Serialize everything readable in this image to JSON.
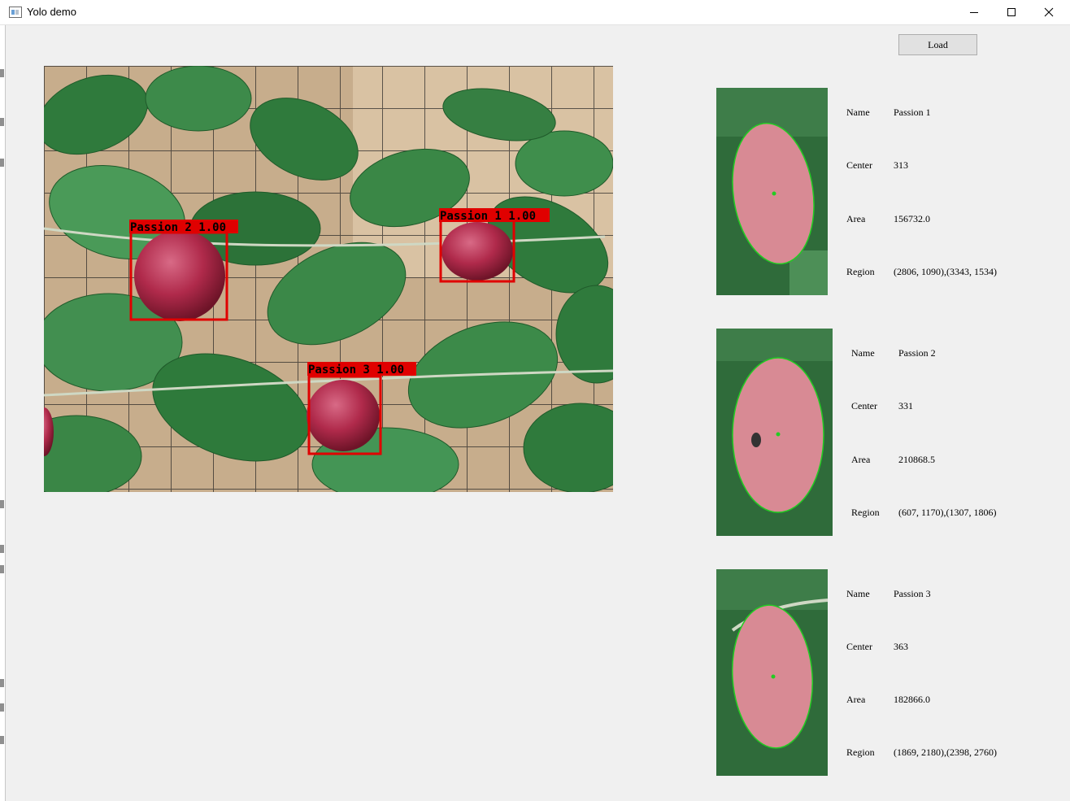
{
  "window": {
    "title": "Yolo demo",
    "icons": {
      "app": "app-window-icon",
      "minimize": "minimize-icon",
      "maximize": "maximize-icon",
      "close": "close-icon"
    }
  },
  "toolbar": {
    "load_label": "Load"
  },
  "detections": [
    {
      "label": "Passion 2 1.00"
    },
    {
      "label": "Passion 1 1.00"
    },
    {
      "label": "Passion 3 1.00"
    }
  ],
  "colors": {
    "box": "#e00000",
    "leaf": "#2f7a3c",
    "fruit": "#b8324f",
    "ellipse": "#22cc22",
    "background": "#f0f0f0"
  },
  "results": [
    {
      "name_label": "Name",
      "name": "Passion 1",
      "center_label": "Center",
      "center": "313",
      "area_label": "Area",
      "area": "156732.0",
      "region_label": "Region",
      "region": "(2806, 1090),(3343, 1534)"
    },
    {
      "name_label": "Name",
      "name": "Passion 2",
      "center_label": "Center",
      "center": "331",
      "area_label": "Area",
      "area": "210868.5",
      "region_label": "Region",
      "region": "(607, 1170),(1307, 1806)"
    },
    {
      "name_label": "Name",
      "name": "Passion 3",
      "center_label": "Center",
      "center": "363",
      "area_label": "Area",
      "area": "182866.0",
      "region_label": "Region",
      "region": "(1869, 2180),(2398, 2760)"
    }
  ]
}
